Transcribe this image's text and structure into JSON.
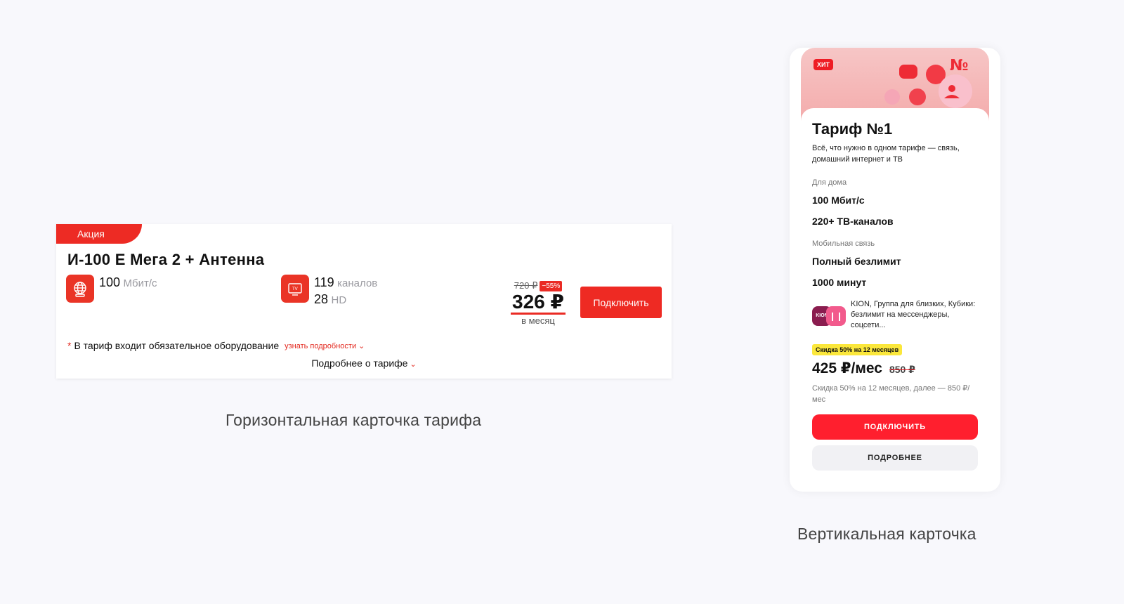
{
  "horizontal_card": {
    "promo_label": "Акция",
    "title": "И-100 Е Мега 2 + Антенна",
    "internet": {
      "value": "100",
      "unit": "Мбит/с",
      "icon": "globe-icon"
    },
    "tv": {
      "channels": "119",
      "channels_unit": "каналов",
      "hd": "28",
      "hd_unit": "HD",
      "icon": "tv-icon"
    },
    "price": {
      "old": "720 ₽",
      "discount": "−55%",
      "current": "326 ₽",
      "period": "в месяц"
    },
    "connect_label": "Подключить",
    "equipment_note": "В тариф входит обязательное оборудование",
    "note_star": "*",
    "learn_more": "узнать подробности",
    "details_link": "Подробнее о тарифе"
  },
  "horizontal_caption": "Горизонтальная карточка тарифа",
  "vertical_card": {
    "badge": "ХИТ",
    "title": "Тариф №1",
    "description": "Всё, что нужно в одном тарифе — связь, домашний интернет и ТВ",
    "home_section": "Для дома",
    "home_items": [
      "100 Мбит/с",
      "220+ ТВ-каналов"
    ],
    "mobile_section": "Мобильная связь",
    "mobile_items": [
      "Полный безлимит",
      "1000 минут"
    ],
    "services_text": "KION, Группа для близких, Кубики: безлимит на мессенджеры, соцсети...",
    "promo_tag": "Скидка 50% на 12 месяцев",
    "price_current": "425 ₽/мес",
    "price_old": "850 ₽",
    "discount_note": "Скидка 50% на 12 месяцев, далее — 850 ₽/мес",
    "connect_label": "ПОДКЛЮЧИТЬ",
    "more_label": "ПОДРОБНЕЕ"
  },
  "vertical_caption": "Вертикальная карточка",
  "colors": {
    "accent": "#ee2a23",
    "yellow": "#fbe73b",
    "background": "#f8f8fc"
  }
}
